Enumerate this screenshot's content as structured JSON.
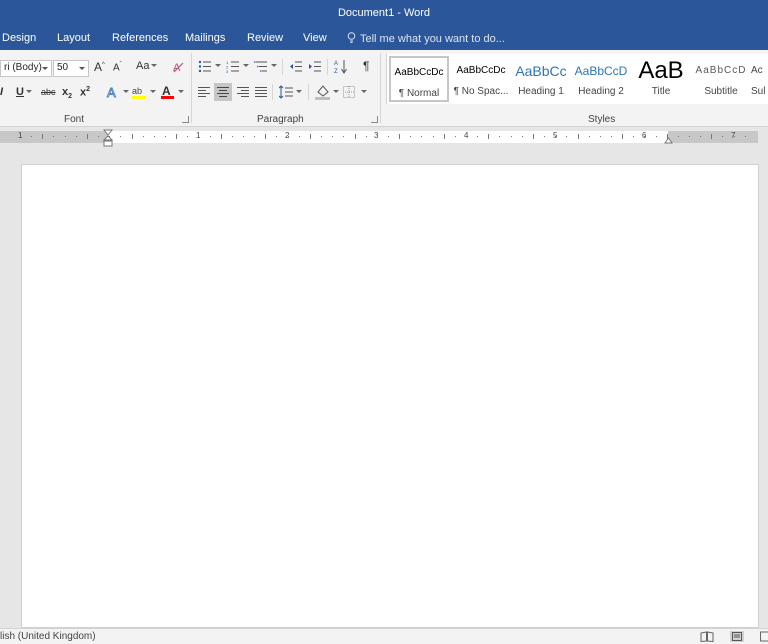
{
  "window": {
    "title": "Document1 - Word"
  },
  "tabs": [
    "Design",
    "Layout",
    "References",
    "Mailings",
    "Review",
    "View"
  ],
  "tell_me": {
    "placeholder": "Tell me what you want to do..."
  },
  "font": {
    "name": "ri (Body)",
    "size": "50",
    "group_label": "Font"
  },
  "font_buttons": {
    "change_case": "Aa",
    "strike": "abc",
    "subscript": "x",
    "superscript": "x"
  },
  "paragraph": {
    "group_label": "Paragraph"
  },
  "styles": {
    "group_label": "Styles",
    "items": [
      {
        "preview": "AaBbCcDc",
        "name": "¶ Normal"
      },
      {
        "preview": "AaBbCcDc",
        "name": "¶ No Spac..."
      },
      {
        "preview": "AaBbCc",
        "name": "Heading 1"
      },
      {
        "preview": "AaBbCcD",
        "name": "Heading 2"
      },
      {
        "preview": "AaB",
        "name": "Title"
      },
      {
        "preview": "AaBbCcD",
        "name": "Subtitle"
      },
      {
        "preview": "Ac",
        "name": "Sul"
      }
    ]
  },
  "ruler": {
    "numbers": [
      "1",
      "1",
      "2",
      "3",
      "4",
      "5",
      "6",
      "7"
    ]
  },
  "status": {
    "language": "lish (United Kingdom)"
  },
  "colors": {
    "brand": "#2b579a",
    "highlight": "#ffff00",
    "font_color": "#ff0000"
  }
}
